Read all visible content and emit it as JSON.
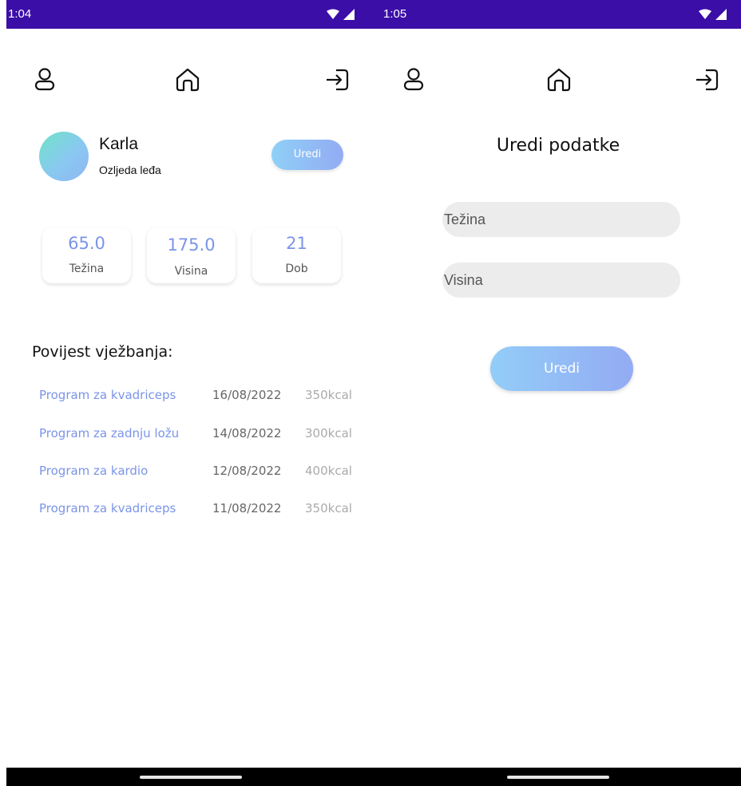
{
  "left_screen": {
    "status_time": "1:04",
    "user": {
      "name": "Karla",
      "injury": "Ozljeda leđa"
    },
    "edit_button_label": "Uredi",
    "stats": [
      {
        "value": "65.0",
        "label": "Težina"
      },
      {
        "value": "175.0",
        "label": "Visina"
      },
      {
        "value": "21",
        "label": "Dob"
      }
    ],
    "history_title": "Povijest vježbanja:",
    "history": [
      {
        "program": "Program za kvadriceps",
        "date": "16/08/2022",
        "kcal": "350kcal"
      },
      {
        "program": "Program za zadnju ložu",
        "date": "14/08/2022",
        "kcal": "300kcal"
      },
      {
        "program": "Program za kardio",
        "date": "12/08/2022",
        "kcal": "400kcal"
      },
      {
        "program": "Program za kvadriceps",
        "date": "11/08/2022",
        "kcal": "350kcal"
      }
    ]
  },
  "right_screen": {
    "status_time": "1:05",
    "title": "Uredi podatke",
    "weight_placeholder": "Težina",
    "height_placeholder": "Visina",
    "submit_label": "Uredi"
  },
  "icons": {
    "profile": "profile-icon",
    "home": "home-icon",
    "logout": "logout-icon"
  },
  "colors": {
    "status_bar": "#3b0ea8",
    "accent": "#7b94e8",
    "gradient_start": "#8fd0f7",
    "gradient_end": "#93abf3"
  }
}
